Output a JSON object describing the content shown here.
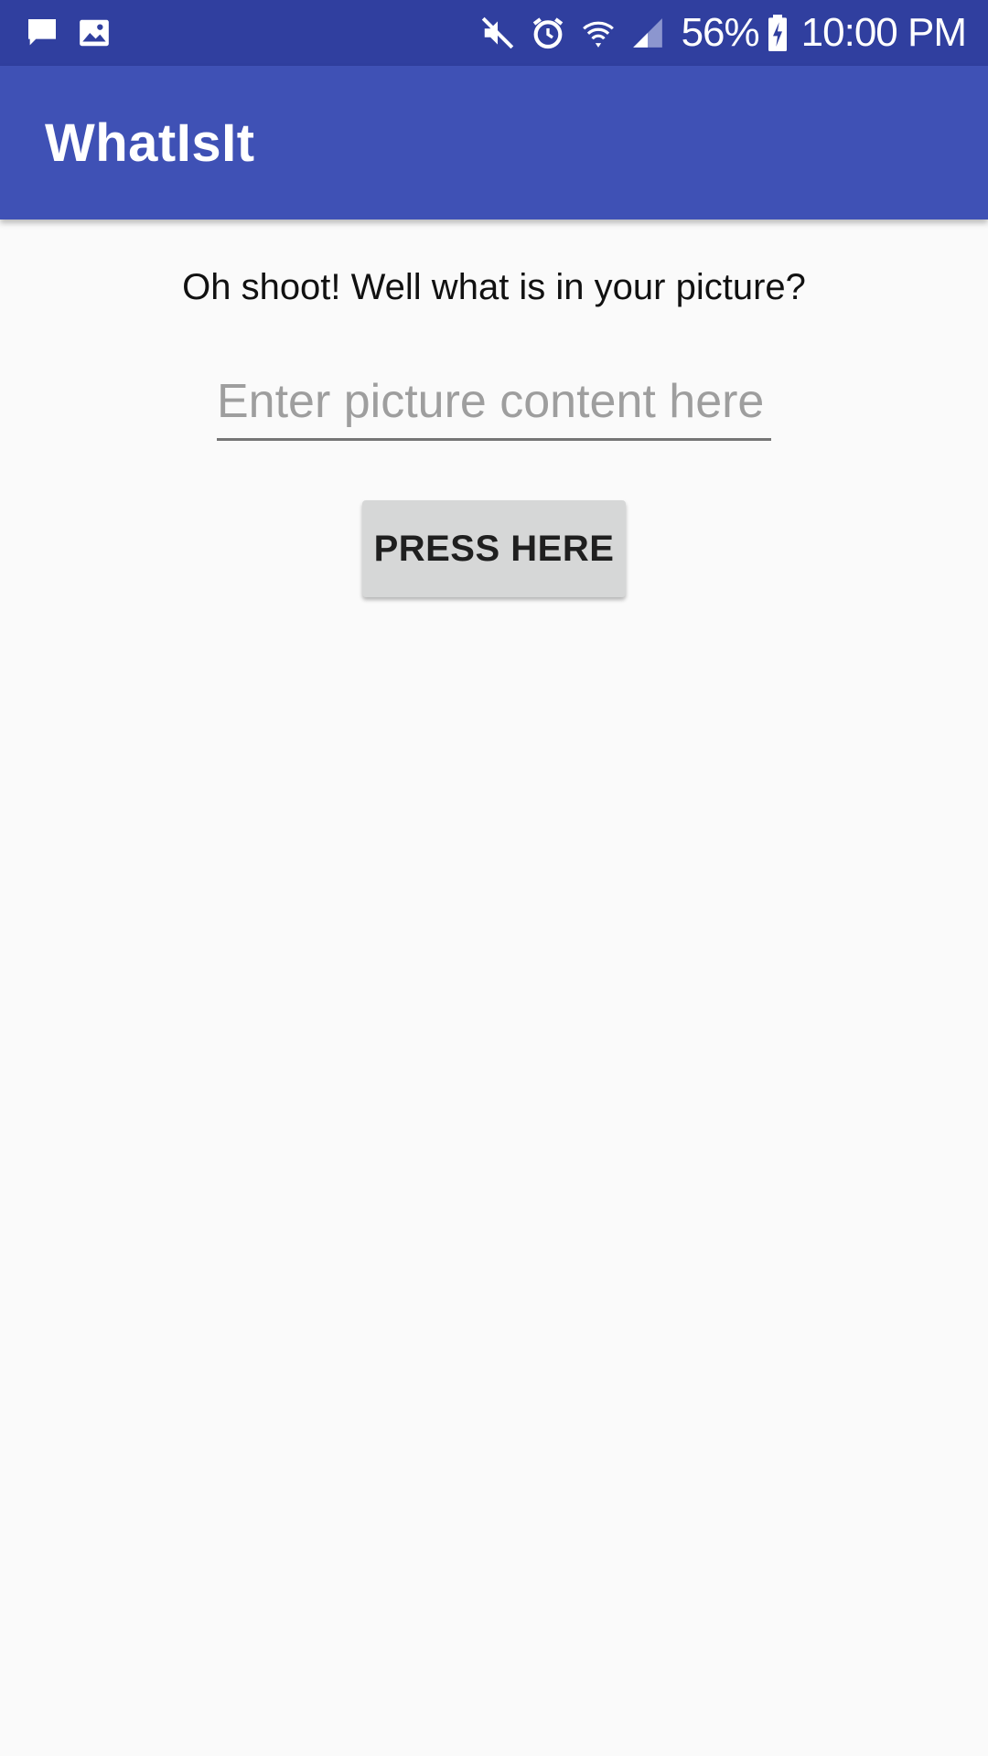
{
  "status_bar": {
    "battery_percent": "56%",
    "time": "10:00 PM",
    "left_icons": [
      "message-icon",
      "image-icon"
    ],
    "right_icons": [
      "mute-icon",
      "alarm-icon",
      "wifi-icon",
      "signal-icon",
      "battery-charging-icon"
    ]
  },
  "app_bar": {
    "title": "WhatIsIt"
  },
  "main": {
    "prompt": "Oh shoot! Well what is in your picture?",
    "input": {
      "placeholder": "Enter picture content here",
      "value": ""
    },
    "button_label": "PRESS HERE"
  },
  "colors": {
    "status_bar": "#303f9f",
    "app_bar": "#3f51b5",
    "background": "#fafafa",
    "button": "#d6d7d7"
  }
}
